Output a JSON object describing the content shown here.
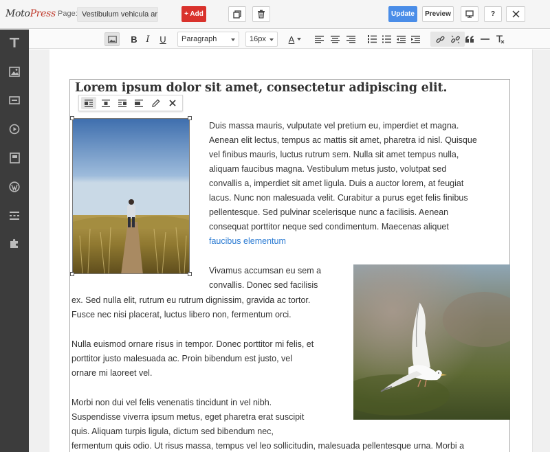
{
  "app": {
    "logo_part1": "Moto",
    "logo_part2": "Press",
    "page_label": "Page:",
    "page_value": "Vestibulum vehicula ar...",
    "add_label": "+ Add",
    "update_label": "Update",
    "preview_label": "Preview",
    "help_label": "?"
  },
  "icons": {
    "duplicate": "duplicate-icon",
    "trash": "trash-icon",
    "desktop": "desktop-icon",
    "close": "close-icon"
  },
  "sidebar": {
    "items": [
      {
        "name": "text-widget",
        "icon": "text-icon"
      },
      {
        "name": "image-widget",
        "icon": "image-icon"
      },
      {
        "name": "button-widget",
        "icon": "button-icon"
      },
      {
        "name": "video-widget",
        "icon": "play-icon"
      },
      {
        "name": "layout-widget",
        "icon": "layout-icon"
      },
      {
        "name": "wordpress-widget",
        "icon": "wordpress-icon"
      },
      {
        "name": "section-widget",
        "icon": "sections-icon"
      },
      {
        "name": "extensions-widget",
        "icon": "puzzle-icon"
      }
    ]
  },
  "format_toolbar": {
    "bold": "B",
    "italic": "I",
    "underline": "U",
    "block_format": "Paragraph",
    "font_size": "16px",
    "font_color": "A"
  },
  "content": {
    "heading": "Lorem ipsum dolor sit amet, consectetur adipiscing elit.",
    "para1": [
      "Duis massa mauris, vulputate vel pretium eu, imperdiet et magna.",
      "Aenean elit lectus, tempus ac mattis sit amet, pharetra id nisl. Quisque",
      "vel finibus mauris, luctus rutrum sem. Nulla sit amet tempus nulla,",
      "aliquam faucibus magna. Vestibulum metus justo, volutpat sed",
      "convallis a, imperdiet sit amet ligula. Duis a auctor lorem, at feugiat",
      "lacus. Nunc non malesuada velit. Curabitur a purus eget felis finibus",
      "pellentesque. Sed pulvinar scelerisque nunc a facilisis. Aenean",
      "consequat porttitor neque sed condimentum. Maecenas aliquet"
    ],
    "para1_link": "faucibus elementum",
    "para2": [
      "Vivamus accumsan eu sem a",
      "convallis. Donec sed facilisis",
      "ex. Sed nulla elit, rutrum eu rutrum dignissim, gravida ac tortor.",
      "Fusce nec nisi placerat, luctus libero non, fermentum orci."
    ],
    "para3": [
      "Nulla euismod ornare risus in tempor. Donec porttitor mi felis, et",
      "porttitor justo malesuada ac. Proin bibendum est justo, vel",
      "ornare mi laoreet vel."
    ],
    "para4": [
      "Morbi non dui vel felis venenatis tincidunt in vel nibh.",
      "Suspendisse viverra ipsum metus, eget pharetra erat suscipit",
      "quis. Aliquam turpis ligula, dictum sed bibendum nec,",
      "fermentum quis odio. Ut risus massa, tempus vel leo sollicitudin, malesuada pellentesque urna. Morbi a"
    ]
  }
}
